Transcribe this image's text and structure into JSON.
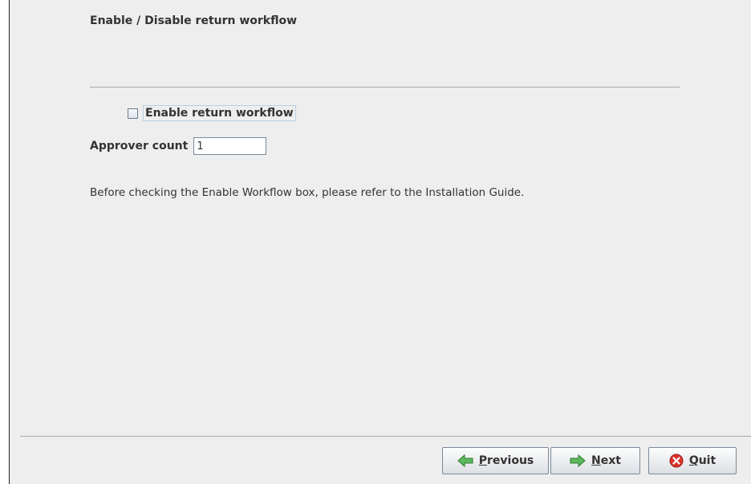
{
  "page": {
    "title": "Enable / Disable return workflow",
    "info_text": "Before checking the Enable Workflow box, please refer to the Installation Guide."
  },
  "workflow_checkbox": {
    "label": "Enable return workflow",
    "checked": false
  },
  "approver_count": {
    "label": "Approver count",
    "value": "1"
  },
  "buttons": {
    "previous": {
      "mnemonic": "P",
      "rest": "revious",
      "icon": "arrow-left-icon"
    },
    "next": {
      "mnemonic": "N",
      "rest": "ext",
      "icon": "arrow-right-icon"
    },
    "quit": {
      "mnemonic": "Q",
      "rest": "uit",
      "icon": "close-circle-icon"
    }
  },
  "colors": {
    "panel_background": "#eeeeee",
    "arrow_green": "#5cb85c",
    "quit_red": "#d9342b"
  }
}
